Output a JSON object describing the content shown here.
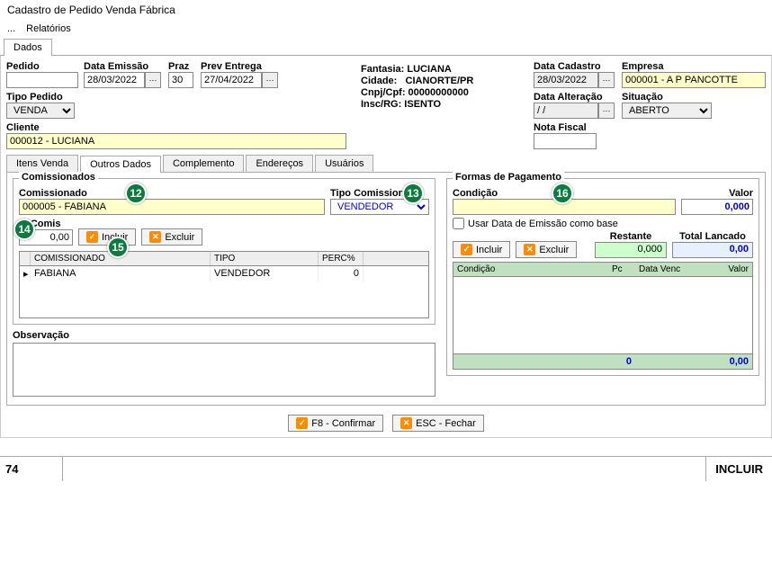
{
  "window": {
    "title": "Cadastro de Pedido Venda Fábrica"
  },
  "menu": {
    "ellipsis": "...",
    "relatorios": "Relatórios"
  },
  "mainTab": {
    "dados": "Dados"
  },
  "header": {
    "pedido_label": "Pedido",
    "pedido_value": "",
    "data_emissao_label": "Data Emissão",
    "data_emissao_value": "28/03/2022",
    "praz_label": "Praz",
    "praz_value": "30",
    "prev_entrega_label": "Prev Entrega",
    "prev_entrega_value": "27/04/2022",
    "tipo_pedido_label": "Tipo Pedido",
    "tipo_pedido_value": "VENDA",
    "cliente_label": "Cliente",
    "cliente_value": "000012 - LUCIANA",
    "fantasia_label": "Fantasia:",
    "fantasia_value": "LUCIANA",
    "cidade_label": "Cidade:",
    "cidade_value": "CIANORTE/PR",
    "cnpj_label": "Cnpj/Cpf:",
    "cnpj_value": "00000000000",
    "insc_label": "Insc/RG:",
    "insc_value": "ISENTO",
    "data_cadastro_label": "Data Cadastro",
    "data_cadastro_value": "28/03/2022",
    "data_alteracao_label": "Data Alteração",
    "data_alteracao_value": "/ /",
    "empresa_label": "Empresa",
    "empresa_value": "000001 - A P PANCOTTE",
    "situacao_label": "Situação",
    "situacao_value": "ABERTO",
    "nota_fiscal_label": "Nota Fiscal",
    "nota_fiscal_value": ""
  },
  "subTabs": {
    "itens": "Itens Venda",
    "outros": "Outros Dados",
    "complemento": "Complemento",
    "enderecos": "Endereços",
    "usuarios": "Usuários"
  },
  "comissionados": {
    "group_title": "Comissionados",
    "comissionado_label": "Comissionado",
    "comissionado_value": "000005 - FABIANA",
    "tipo_label": "Tipo Comissionado",
    "tipo_value": "VENDEDOR",
    "pct_label": "% Comis",
    "pct_value": "0,00",
    "incluir": "Incluir",
    "excluir": "Excluir",
    "grid": {
      "h1": "COMISSIONADO",
      "h2": "TIPO",
      "h3": "PERC%",
      "r1c1": "FABIANA",
      "r1c2": "VENDEDOR",
      "r1c3": "0"
    }
  },
  "observacao_label": "Observação",
  "pagamento": {
    "group_title": "Formas de Pagamento",
    "condicao_label": "Condição",
    "condicao_value": "",
    "valor_label": "Valor",
    "valor_value": "0,000",
    "usar_data": "Usar Data de Emissão como base",
    "incluir": "Incluir",
    "excluir": "Excluir",
    "restante_label": "Restante",
    "restante_value": "0,000",
    "total_label": "Total  Lancado",
    "total_value": "0,00",
    "grid": {
      "h1": "Condição",
      "h2": "Pc",
      "h3": "Data Venc",
      "h4": "Valor",
      "foot_left": "0",
      "foot_right": "0,00"
    }
  },
  "footer": {
    "confirmar": "F8 - Confirmar",
    "fechar": "ESC - Fechar"
  },
  "status": {
    "left": "74",
    "right": "INCLUIR"
  },
  "markers": {
    "m12": "12",
    "m13": "13",
    "m14": "14",
    "m15": "15",
    "m16": "16"
  }
}
